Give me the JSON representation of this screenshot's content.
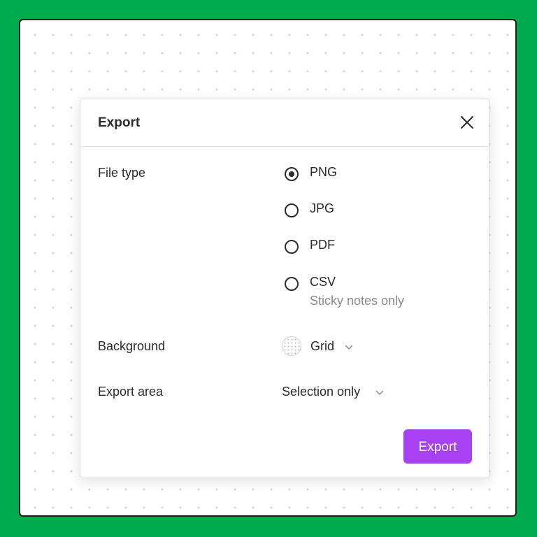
{
  "dialog": {
    "title": "Export",
    "close_icon": "close-icon"
  },
  "file_type": {
    "label": "File type",
    "options": [
      {
        "label": "PNG",
        "selected": true
      },
      {
        "label": "JPG",
        "selected": false
      },
      {
        "label": "PDF",
        "selected": false
      },
      {
        "label": "CSV",
        "selected": false,
        "hint": "Sticky notes only"
      }
    ]
  },
  "background": {
    "label": "Background",
    "value": "Grid",
    "icon": "grid-swatch-icon"
  },
  "export_area": {
    "label": "Export area",
    "value": "Selection only"
  },
  "actions": {
    "export_label": "Export"
  },
  "colors": {
    "page_background": "#00ab4e",
    "accent": "#a741f2",
    "text": "#2b2b2b",
    "muted_text": "#8a8a8a"
  }
}
